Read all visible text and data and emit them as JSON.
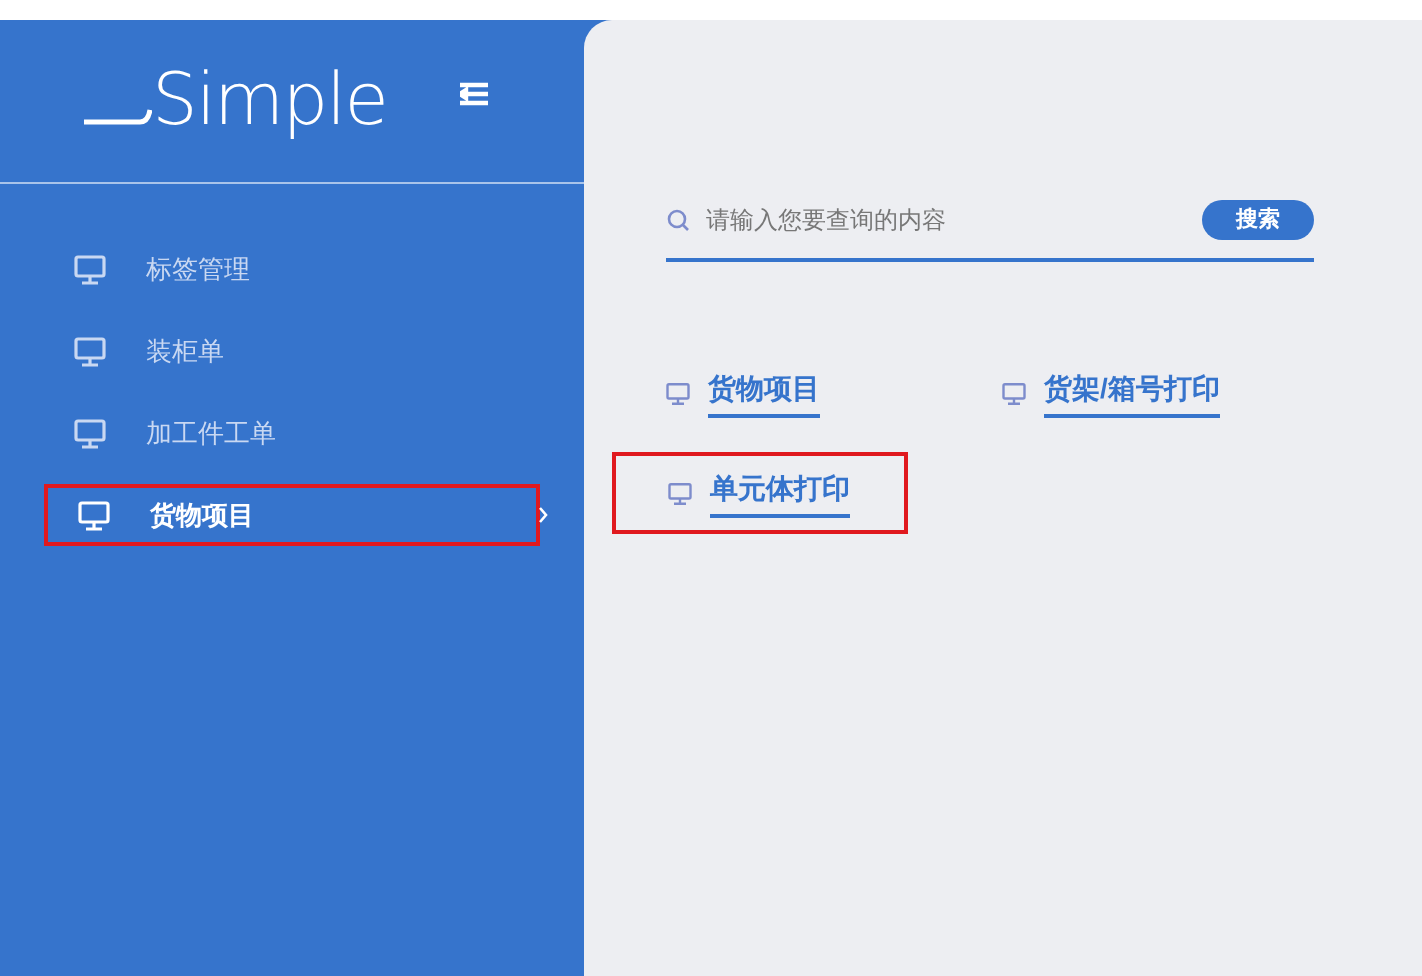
{
  "logo": {
    "text": "Simple"
  },
  "sidebar": {
    "items": [
      {
        "label": "标签管理",
        "selected": false
      },
      {
        "label": "装柜单",
        "selected": false
      },
      {
        "label": "加工件工单",
        "selected": false
      },
      {
        "label": "货物项目",
        "selected": true
      }
    ]
  },
  "search": {
    "placeholder": "请输入您要查询的内容",
    "button": "搜索"
  },
  "links": [
    {
      "label": "货物项目",
      "highlighted": false
    },
    {
      "label": "货架/箱号打印",
      "highlighted": false
    },
    {
      "label": "单元体打印",
      "highlighted": true
    }
  ]
}
